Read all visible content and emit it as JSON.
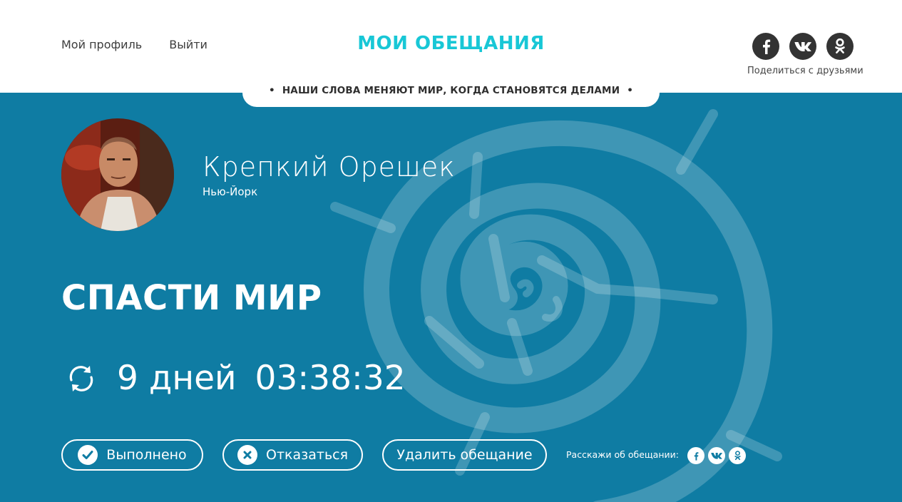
{
  "header": {
    "nav": {
      "profile": "Мой профиль",
      "logout": "Выйти"
    },
    "logo": "МОИ ОБЕЩАНИЯ",
    "share": {
      "label": "Поделиться с друзьями",
      "icons": [
        "facebook-icon",
        "vk-icon",
        "odnoklassniki-icon"
      ]
    },
    "slogan": "НАШИ СЛОВА МЕНЯЮТ МИР, КОГДА СТАНОВЯТСЯ ДЕЛАМИ",
    "slogan_bullet": "•"
  },
  "profile": {
    "name": "Крепкий Орешек",
    "city": "Нью-Йорк"
  },
  "promise": {
    "title": "СПАСТИ МИР",
    "timer": {
      "days": "9 дней",
      "time": "03:38:32"
    }
  },
  "actions": {
    "done": "Выполнено",
    "refuse": "Отказаться",
    "delete": "Удалить обещание",
    "tell_label": "Расскажи об обещании:"
  },
  "colors": {
    "accent": "#18c7d6",
    "panel": "#0f7ca3",
    "social_dark": "#333333"
  }
}
